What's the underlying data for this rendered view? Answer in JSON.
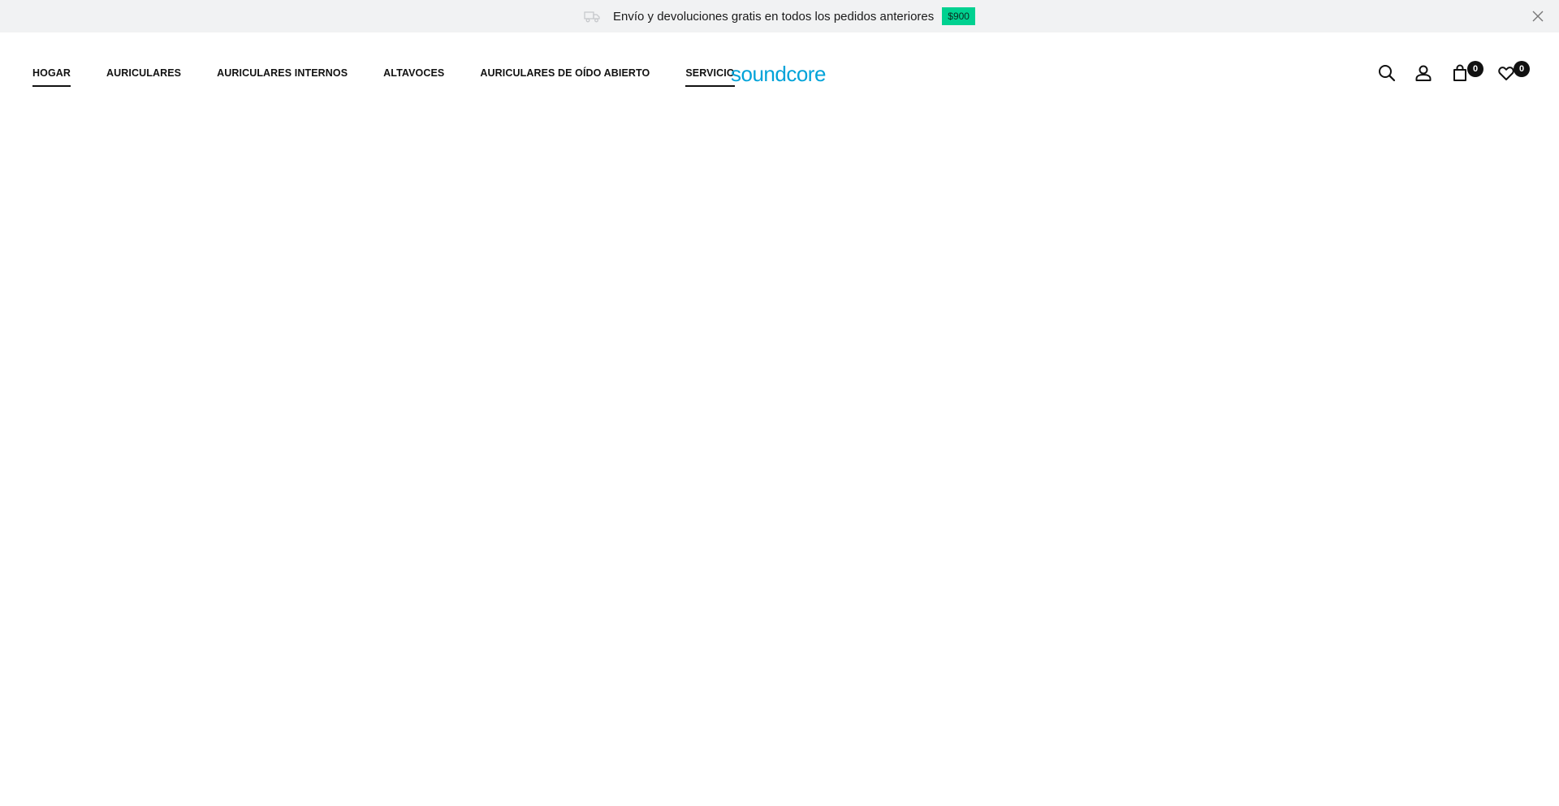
{
  "announcement": {
    "text": "Envío y devoluciones gratis en todos los pedidos anteriores",
    "badge": "$900",
    "badge_color": "#00d190",
    "background": "#f1f2f3",
    "icons": [
      "truck-icon",
      "close-icon"
    ]
  },
  "nav": {
    "items": [
      {
        "label": "HOGAR"
      },
      {
        "label": "AURICULARES"
      },
      {
        "label": "AURICULARES INTERNOS"
      },
      {
        "label": "ALTAVOCES"
      },
      {
        "label": "AURICULARES DE OÍDO ABIERTO"
      },
      {
        "label": "SERVICIO"
      }
    ]
  },
  "logo": {
    "text": "soundcore",
    "color": "#00a3d9"
  },
  "header_actions": {
    "icons": [
      "search-icon",
      "account-icon",
      "cart-icon",
      "wishlist-icon"
    ],
    "cart_count": "0",
    "wishlist_count": "0"
  }
}
